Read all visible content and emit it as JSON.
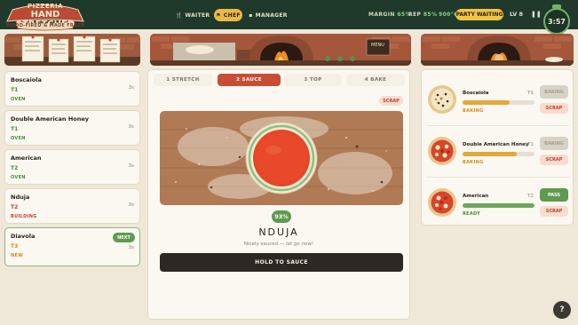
{
  "brand": {
    "line1": "PIZZERIA",
    "line2": "HAND STRETCHED",
    "line3": "WOOD-FIRED & MADE FRESH"
  },
  "roles": [
    {
      "icon": "waiter-icon",
      "label": "WAITER",
      "active": false
    },
    {
      "icon": "chef-icon",
      "label": "CHEF",
      "active": true
    },
    {
      "icon": "manager-icon",
      "label": "MANAGER",
      "active": false
    }
  ],
  "stats": {
    "margin_label": "MARGIN",
    "margin_value": "65%",
    "rep_label": "REP",
    "rep_value": "85%",
    "temp": "900°C"
  },
  "party_waiting": "PARTY WAITING",
  "level": "LV 8",
  "pause_icon": "pause-icon",
  "timer": "3:57",
  "tickets": [
    {
      "name": "Boscaiola",
      "table": "T1",
      "status": "OVEN",
      "time": "3s",
      "status_color": "#3f8f3a",
      "table_color": "#3f8f3a"
    },
    {
      "name": "Double American Honey",
      "table": "T1",
      "status": "OVEN",
      "time": "3s",
      "status_color": "#3f8f3a",
      "table_color": "#3f8f3a"
    },
    {
      "name": "American",
      "table": "T2",
      "status": "OVEN",
      "time": "3s",
      "status_color": "#3f8f3a",
      "table_color": "#3f8f3a"
    },
    {
      "name": "Nduja",
      "table": "T2",
      "status": "BUILDING",
      "time": "3s",
      "status_color": "#c3402d",
      "table_color": "#c3402d"
    },
    {
      "name": "Diavola",
      "table": "T3",
      "status": "NEW",
      "time": "3s",
      "status_color": "#d48a1a",
      "table_color": "#d48a1a",
      "badge": "NEXT"
    }
  ],
  "steps": [
    "1 STRETCH",
    "2 SAUCE",
    "3 TOP",
    "4 BAKE"
  ],
  "active_step": 1,
  "scrap_label": "SCRAP",
  "sauce_coverage_percent": 93,
  "sauce_coverage_label": "93%",
  "current_pizza": "NDUJA",
  "sauce_message": "Nicely sauced — let go now!",
  "hold_button": "HOLD TO SAUCE",
  "oven": [
    {
      "name": "Boscaiola",
      "table": "T1",
      "progress": 0.66,
      "state": "BAKING",
      "state_color": "#d48a1a",
      "bar_color": "#e2a93a",
      "button": "BAKING",
      "button_enabled": false,
      "scrap": "SCRAP"
    },
    {
      "name": "Double American Honey",
      "table": "T1",
      "progress": 0.75,
      "state": "BAKING",
      "state_color": "#d48a1a",
      "bar_color": "#e2a93a",
      "button": "BAKING",
      "button_enabled": false,
      "scrap": "SCRAP"
    },
    {
      "name": "American",
      "table": "T2",
      "progress": 1.0,
      "state": "READY",
      "state_color": "#3f8f3a",
      "bar_color": "#6fa65c",
      "button": "PASS",
      "button_enabled": true,
      "scrap": "SCRAP"
    }
  ],
  "help_label": "?"
}
